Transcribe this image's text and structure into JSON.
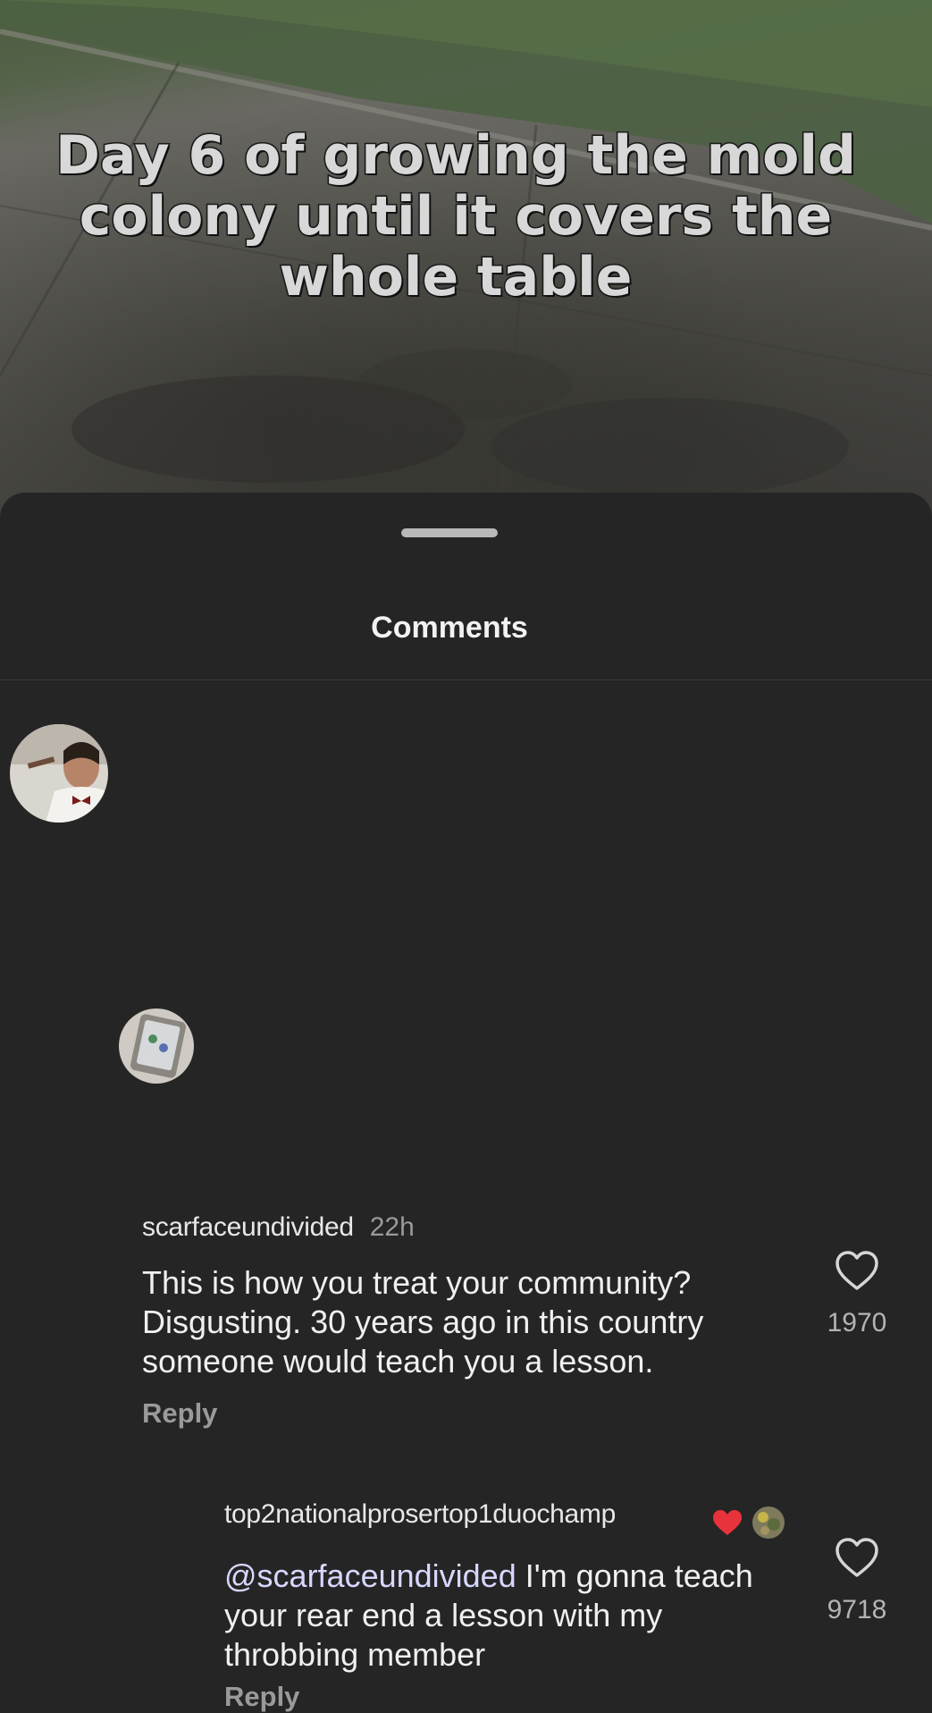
{
  "video": {
    "caption": "Day 6 of growing the mold colony until it covers the whole table"
  },
  "sheet": {
    "title": "Comments"
  },
  "comments": [
    {
      "username": "scarfaceundivided",
      "time": "22h",
      "text": "This is how you treat your community? Disgusting. 30 years ago in this country someone would teach you a lesson.",
      "reply_label": "Reply",
      "like_count": "1970",
      "avatar_icon": "avatar-photo-icon"
    },
    {
      "username": "top2nationalprosertop1duochamp",
      "mention": "@scarfaceundivided",
      "text": " I'm gonna teach your rear end a lesson with my throbbing member",
      "reply_label": "Reply",
      "like_count": "9718",
      "creator_liked_icon": "heart-filled-icon",
      "creator_avatar_icon": "creator-avatar-icon"
    }
  ],
  "colors": {
    "background": "#252525",
    "liked_heart": "#e8323c",
    "muted_text": "#9a9a9a"
  }
}
